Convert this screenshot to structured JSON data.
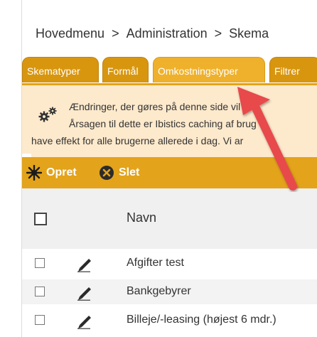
{
  "breadcrumb": {
    "items": [
      "Hovedmenu",
      "Administration",
      "Skema"
    ],
    "separator": ">"
  },
  "tabs": [
    {
      "label": "Skematyper",
      "active": false
    },
    {
      "label": "Formål",
      "active": false
    },
    {
      "label": "Omkostningstyper",
      "active": true
    },
    {
      "label": "Filtrer",
      "active": false
    }
  ],
  "info": {
    "line1": "Ændringer, der gøres på denne side vil ha",
    "line2": "Årsagen til dette er Ibistics caching af brug",
    "line3": "have effekt for alle brugerne allerede i dag. Vi ar"
  },
  "toolbar": {
    "create_label": "Opret",
    "delete_label": "Slet"
  },
  "table": {
    "column_name": "Navn",
    "rows": [
      {
        "name": "Afgifter test"
      },
      {
        "name": "Bankgebyrer"
      },
      {
        "name": "Billeje/-leasing (højest 6 mdr.)"
      }
    ]
  },
  "colors": {
    "accent": "#e3a31a",
    "tab_bg": "#d8960f",
    "tab_active": "#efb12c",
    "info_bg": "#fde9cc",
    "arrow": "#e8484c"
  }
}
